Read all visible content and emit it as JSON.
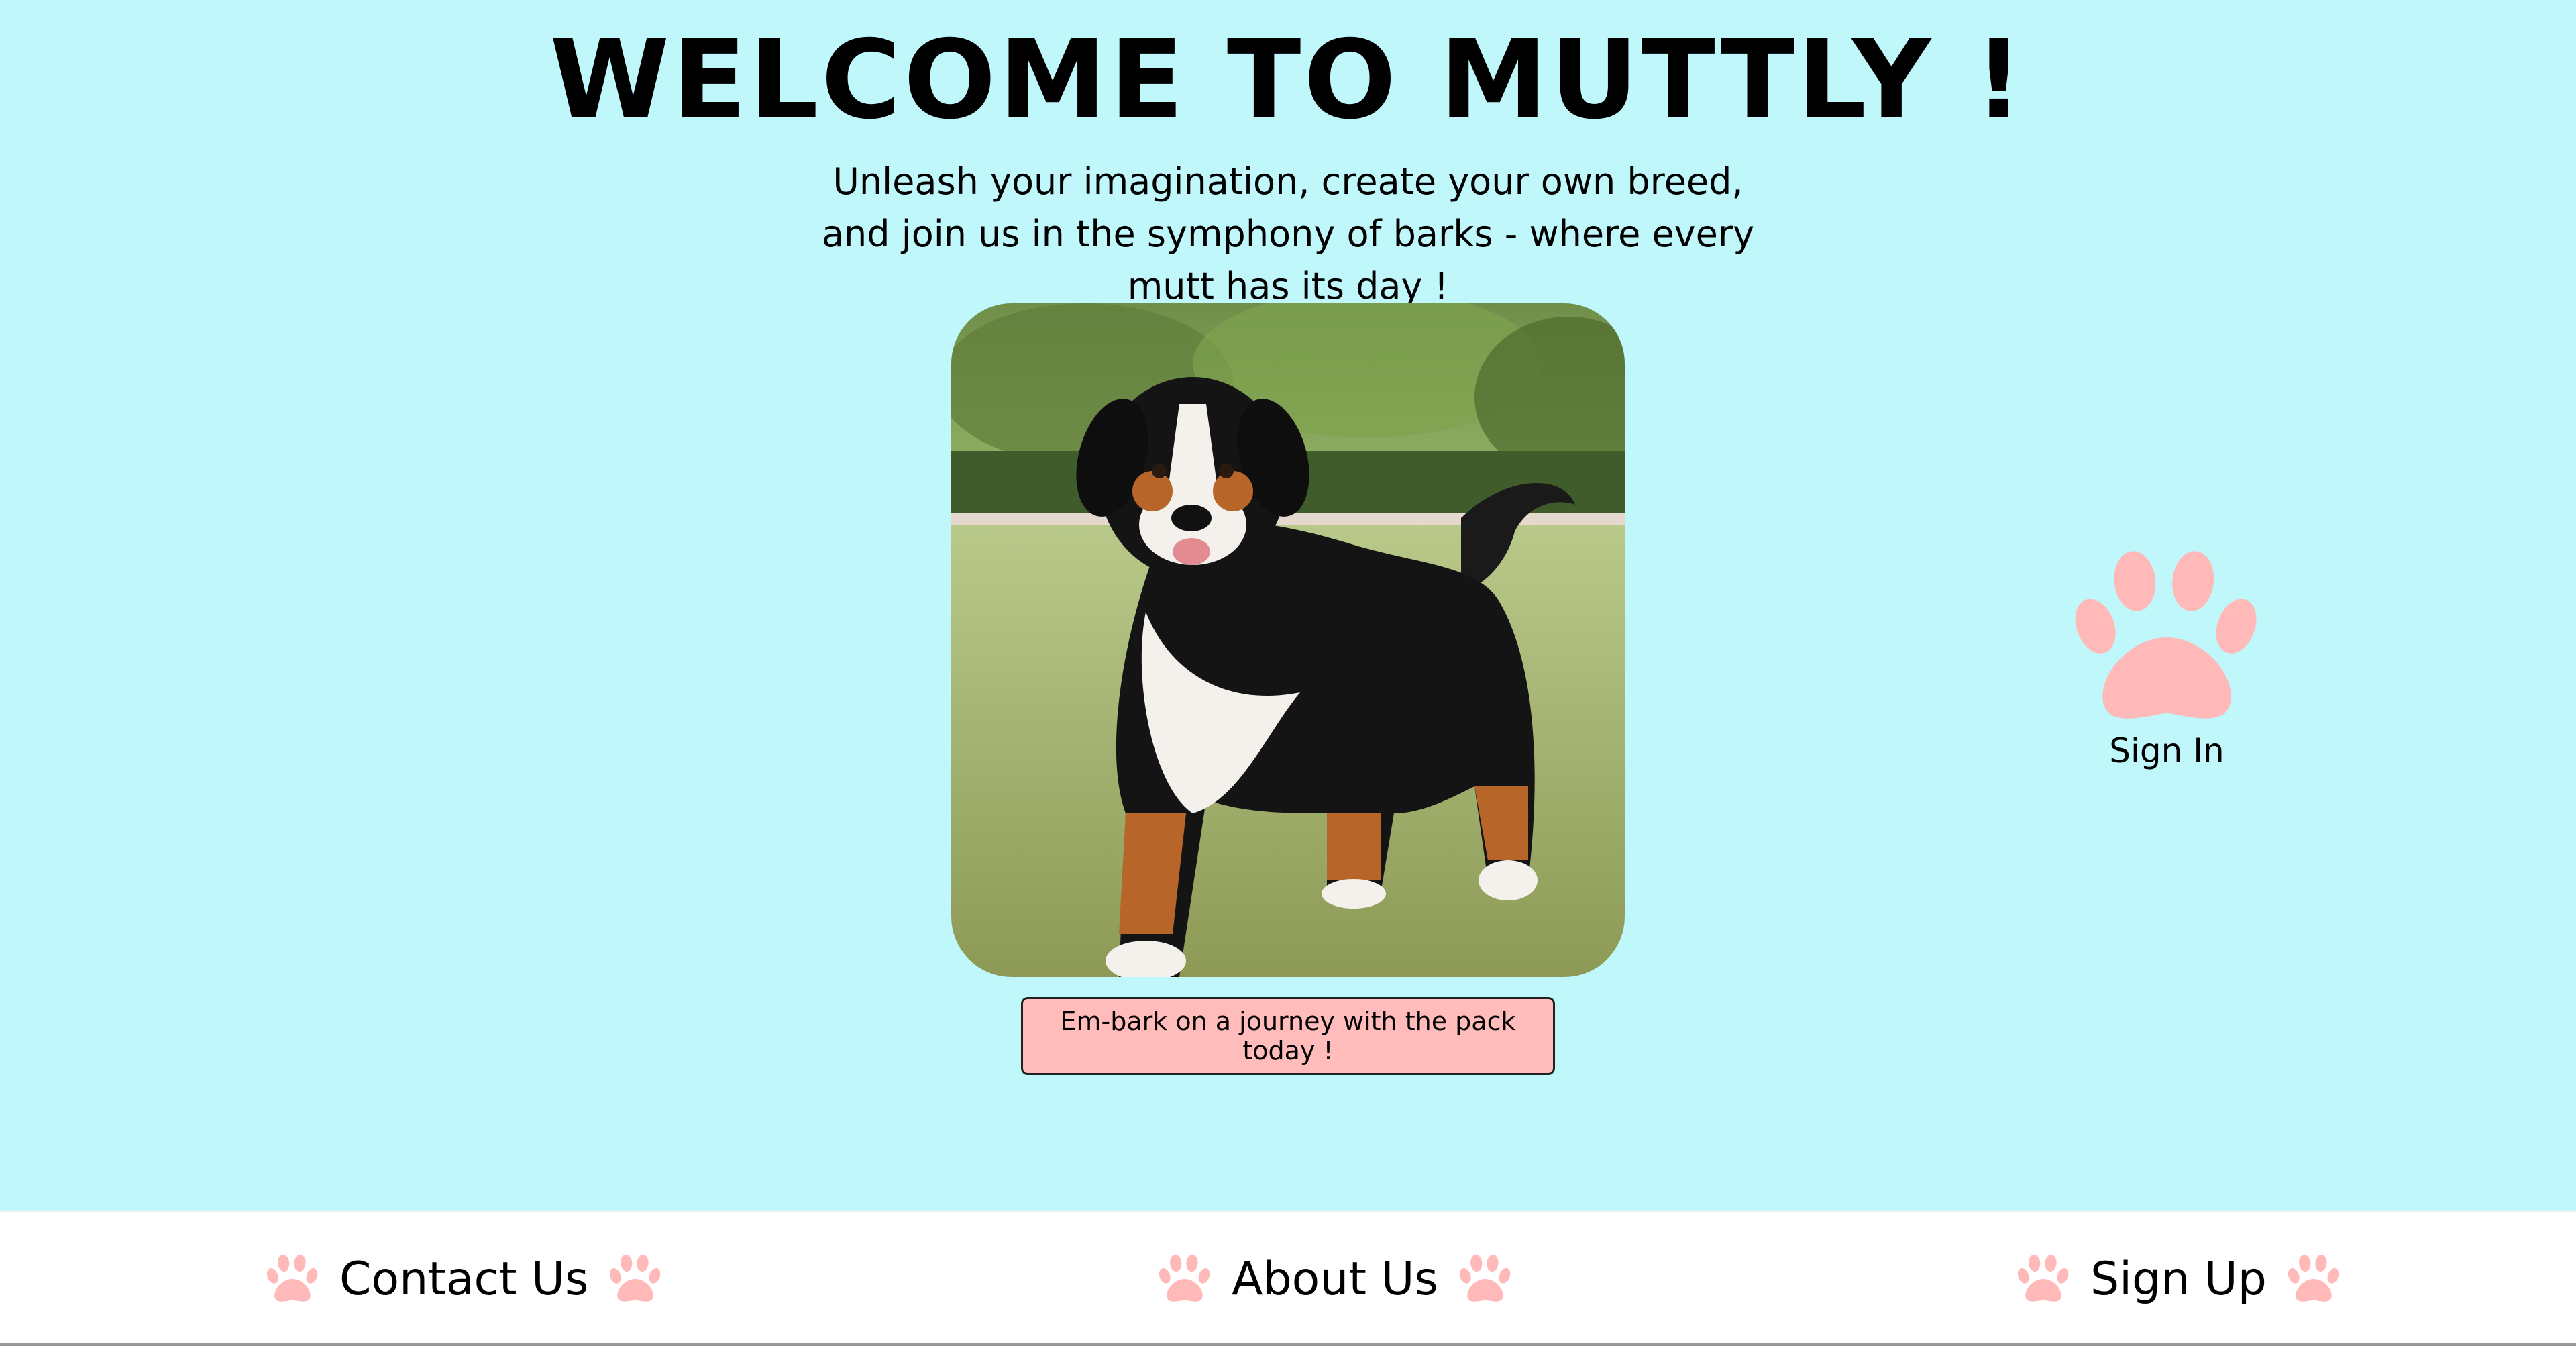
{
  "header": {
    "title": "WELCOME TO MUTTLY !",
    "tagline": "Unleash your imagination, create your own breed, and join us in the symphony of barks - where every mutt has its day !"
  },
  "hero": {
    "image_alt": "Bernese-style mutt dog standing on grass",
    "cta_label": "Em-bark on a journey with the pack today !"
  },
  "side": {
    "signin_label": "Sign In",
    "icon": "paw-icon"
  },
  "footer": {
    "links": [
      {
        "label": "Contact Us",
        "icon": "paw-icon"
      },
      {
        "label": "About Us",
        "icon": "paw-icon"
      },
      {
        "label": "Sign Up",
        "icon": "paw-icon"
      }
    ]
  },
  "colors": {
    "background": "#bff7fb",
    "accent_pink": "#ffbcbb",
    "footer_bg": "#ffffff"
  }
}
